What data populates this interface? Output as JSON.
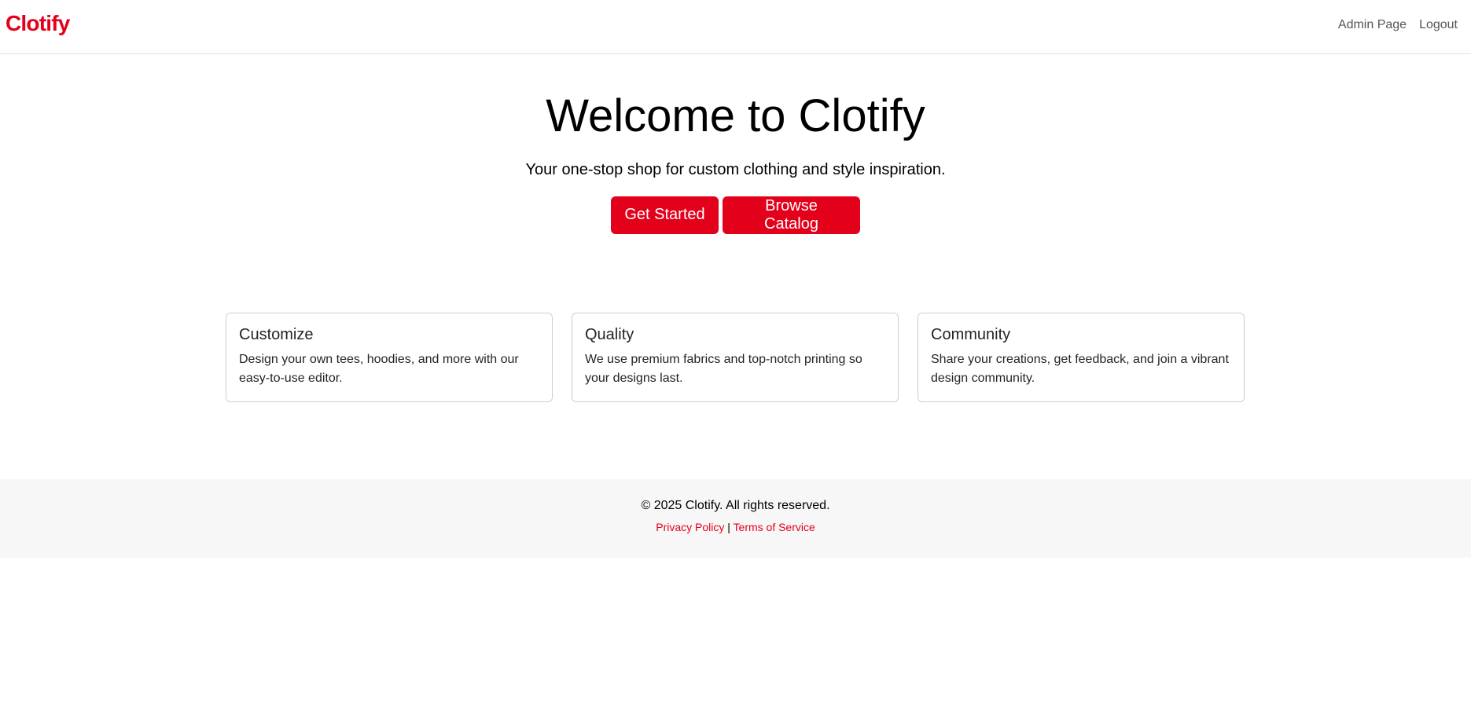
{
  "nav": {
    "brand": "Clotify",
    "links": [
      "Admin Page",
      "Logout"
    ]
  },
  "hero": {
    "title": "Welcome to Clotify",
    "subtitle": "Your one-stop shop for custom clothing and style inspiration.",
    "primary_button": "Get Started",
    "secondary_button": "Browse Catalog"
  },
  "features": [
    {
      "title": "Customize",
      "text": "Design your own tees, hoodies, and more with our easy-to-use editor."
    },
    {
      "title": "Quality",
      "text": "We use premium fabrics and top-notch printing so your designs last."
    },
    {
      "title": "Community",
      "text": "Share your creations, get feedback, and join a vibrant design community."
    }
  ],
  "footer": {
    "copyright": "© 2025 Clotify. All rights reserved.",
    "privacy": "Privacy Policy",
    "separator": "|",
    "terms": "Terms of Service"
  },
  "colors": {
    "brand": "#e3001b",
    "footer_bg": "#f7f7f7"
  }
}
